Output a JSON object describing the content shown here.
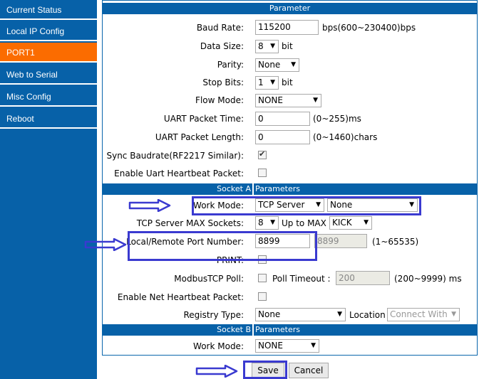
{
  "sidebar": {
    "items": [
      {
        "label": "Current Status"
      },
      {
        "label": "Local IP Config"
      },
      {
        "label": "PORT1"
      },
      {
        "label": "Web to Serial"
      },
      {
        "label": "Misc Config"
      },
      {
        "label": "Reboot"
      }
    ],
    "active_index": 2
  },
  "panel": {
    "title": "Parameter",
    "baud_rate": {
      "label": "Baud Rate:",
      "value": "115200",
      "hint": "bps(600~230400)bps"
    },
    "data_size": {
      "label": "Data Size:",
      "value": "8",
      "unit": "bit"
    },
    "parity": {
      "label": "Parity:",
      "value": "None"
    },
    "stop_bits": {
      "label": "Stop Bits:",
      "value": "1",
      "unit": "bit"
    },
    "flow_mode": {
      "label": "Flow Mode:",
      "value": "NONE"
    },
    "uart_packet_time": {
      "label": "UART Packet Time:",
      "value": "0",
      "hint": "(0~255)ms"
    },
    "uart_packet_length": {
      "label": "UART Packet Length:",
      "value": "0",
      "hint": "(0~1460)chars"
    },
    "sync_baudrate": {
      "label": "Sync Baudrate(RF2217 Similar):",
      "checked": true
    },
    "uart_heartbeat": {
      "label": "Enable Uart Heartbeat Packet:",
      "checked": false
    }
  },
  "socket_a": {
    "header_left": "Socket A",
    "header_right": "Parameters",
    "work_mode": {
      "label": "Work Mode:",
      "value": "TCP Server",
      "secondary": "None"
    },
    "max_sockets": {
      "label": "TCP Server MAX Sockets:",
      "value": "8",
      "up_to": "Up to MAX",
      "policy": "KICK"
    },
    "port_number": {
      "label": "Local/Remote Port Number:",
      "local": "8899",
      "remote": "8899",
      "hint": "(1~65535)"
    },
    "print": {
      "label": "PRINT:",
      "checked": false
    },
    "modbus_poll": {
      "label": "ModbusTCP Poll:",
      "checked": false,
      "timeout_label": "Poll Timeout :",
      "timeout_value": "200",
      "timeout_hint": "(200~9999) ms"
    },
    "net_heartbeat": {
      "label": "Enable Net Heartbeat Packet:",
      "checked": false
    },
    "registry_type": {
      "label": "Registry Type:",
      "value": "None",
      "location_label": "Location",
      "location_value": "Connect With"
    }
  },
  "socket_b": {
    "header_left": "Socket B",
    "header_right": "Parameters",
    "work_mode": {
      "label": "Work Mode:",
      "value": "NONE"
    }
  },
  "actions": {
    "save": "Save",
    "cancel": "Cancel"
  },
  "colors": {
    "nav_bg": "#0761a8",
    "nav_active": "#fb6c00",
    "annotation": "#3a3ad0"
  }
}
